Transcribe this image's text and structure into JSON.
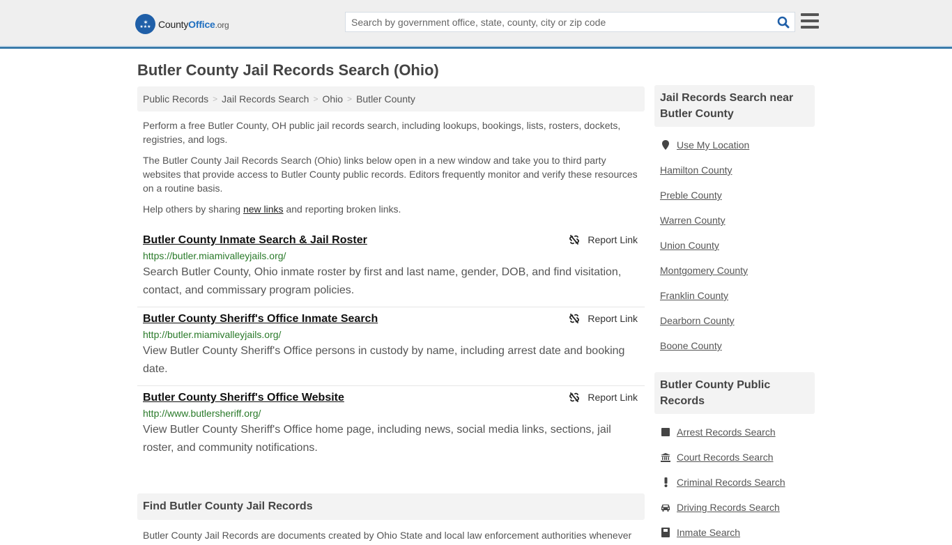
{
  "header": {
    "logo": {
      "prefix": "County",
      "brand": "Office",
      "tld": ".org"
    },
    "search_placeholder": "Search by government office, state, county, city or zip code",
    "search_value": "",
    "search_icon": "search-icon",
    "menu_icon": "hamburger-menu-icon",
    "accent_color": "#3a7cab"
  },
  "page": {
    "title": "Butler County Jail Records Search (Ohio)"
  },
  "breadcrumb": [
    {
      "label": "Public Records"
    },
    {
      "label": "Jail Records Search"
    },
    {
      "label": "Ohio"
    },
    {
      "label": "Butler County"
    }
  ],
  "intro": {
    "p1": "Perform a free Butler County, OH public jail records search, including lookups, bookings, lists, rosters, dockets, registries, and logs.",
    "p2": "The Butler County Jail Records Search (Ohio) links below open in a new window and take you to third party websites that provide access to Butler County public records. Editors frequently monitor and verify these resources on a routine basis.",
    "p3_before": "Help others by sharing ",
    "p3_link": "new links",
    "p3_after": " and reporting broken links."
  },
  "results": [
    {
      "title": "Butler County Inmate Search & Jail Roster",
      "url": "https://butler.miamivalleyjails.org/",
      "description": "Search Butler County, Ohio inmate roster by first and last name, gender, DOB, and find visitation, contact, and commissary program policies.",
      "report_label": "Report Link"
    },
    {
      "title": "Butler County Sheriff's Office Inmate Search",
      "url": "http://butler.miamivalleyjails.org/",
      "description": "View Butler County Sheriff's Office persons in custody by name, including arrest date and booking date.",
      "report_label": "Report Link"
    },
    {
      "title": "Butler County Sheriff's Office Website",
      "url": "http://www.butlersheriff.org/",
      "description": "View Butler County Sheriff's Office home page, including news, social media links, sections, jail roster, and community notifications.",
      "report_label": "Report Link"
    }
  ],
  "find_section": {
    "heading": "Find Butler County Jail Records",
    "body": "Butler County Jail Records are documents created by Ohio State and local law enforcement authorities whenever"
  },
  "sidebar": {
    "nearby": {
      "heading": "Jail Records Search near Butler County",
      "use_location": "Use My Location",
      "counties": [
        "Hamilton County",
        "Preble County",
        "Warren County",
        "Union County",
        "Montgomery County",
        "Franklin County",
        "Dearborn County",
        "Boone County"
      ]
    },
    "public_records": {
      "heading": "Butler County Public Records",
      "items": [
        {
          "label": "Arrest Records Search",
          "icon": "square-icon"
        },
        {
          "label": "Court Records Search",
          "icon": "courthouse-icon"
        },
        {
          "label": "Criminal Records Search",
          "icon": "exclamation-icon"
        },
        {
          "label": "Driving Records Search",
          "icon": "car-icon"
        },
        {
          "label": "Inmate Search",
          "icon": "inmate-icon"
        }
      ]
    }
  }
}
